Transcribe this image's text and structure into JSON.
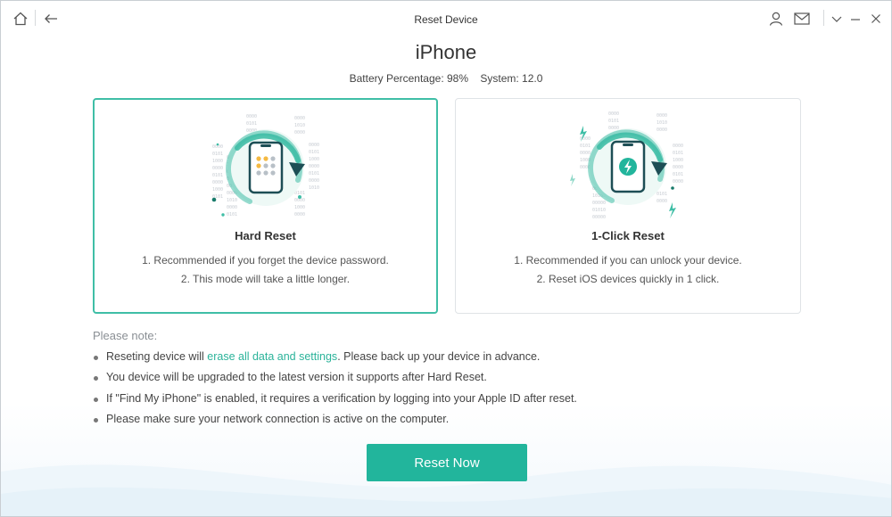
{
  "window": {
    "title": "Reset Device"
  },
  "device": {
    "name": "iPhone",
    "battery": "Battery Percentage: 98%",
    "system": "System: 12.0"
  },
  "modes": [
    {
      "title": "Hard Reset",
      "lines": [
        "1. Recommended if you forget the device password.",
        "2. This mode will take a little longer."
      ],
      "selected": true
    },
    {
      "title": "1-Click Reset",
      "lines": [
        "1. Recommended if you can unlock your device.",
        "2. Reset iOS devices quickly in 1 click."
      ],
      "selected": false
    }
  ],
  "notes": {
    "label": "Please note:",
    "items": [
      {
        "before": "Reseting device will ",
        "link": "erase all data and settings",
        "after": ". Please back up your device in advance."
      },
      {
        "text": "You device will be upgraded to the latest version it supports after Hard Reset."
      },
      {
        "text": "If \"Find My iPhone\" is enabled, it requires a verification by logging into your Apple ID after reset."
      },
      {
        "text": "Please make sure your network connection is active on the computer."
      }
    ]
  },
  "actions": {
    "reset_label": "Reset Now"
  },
  "icons": {
    "home": "home-icon",
    "back": "back-arrow-icon",
    "account": "user-icon",
    "feedback": "mail-icon",
    "minimize_menu": "chevron-down-icon",
    "minimize": "minimize-icon",
    "close": "close-icon"
  },
  "colors": {
    "accent": "#22b59c",
    "selected_border": "#3fbea6",
    "link": "#2bb39a"
  }
}
